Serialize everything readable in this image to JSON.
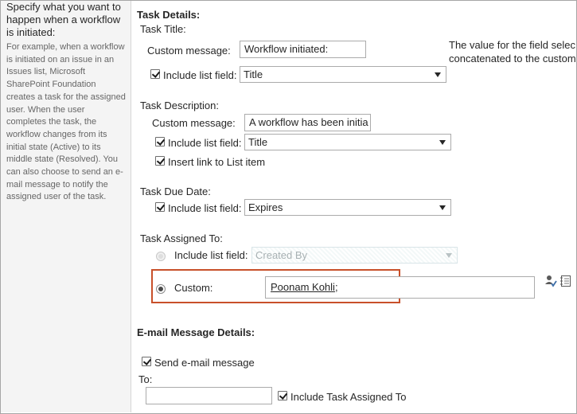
{
  "sidebar": {
    "heading": "Specify what you want to happen when a workflow is initiated:",
    "description": "For example, when a workflow is initiated on an issue in an Issues list, Microsoft SharePoint Foundation creates a task for the assigned user. When the user completes the task, the workflow changes from its initial state (Active) to its middle state (Resolved). You can also choose to send an e-mail message to notify the assigned user of the task."
  },
  "task_details": {
    "title": "Task Details:",
    "task_title": {
      "label": "Task Title:",
      "custom_message_label": "Custom message:",
      "custom_message_value": "Workflow initiated:",
      "include_label": "Include list field:",
      "include_checked": true,
      "field_value": "Title",
      "note_line1": "The value for the field selec",
      "note_line2": "concatenated to the custom"
    },
    "task_description": {
      "label": "Task Description:",
      "custom_message_label": "Custom message:",
      "custom_message_value": "A workflow has been initia",
      "include_label": "Include list field:",
      "include_checked": true,
      "field_value": "Title",
      "insert_link_label": "Insert link to List item",
      "insert_link_checked": true
    },
    "task_due_date": {
      "label": "Task Due Date:",
      "include_label": "Include list field:",
      "include_checked": true,
      "field_value": "Expires"
    },
    "task_assigned_to": {
      "label": "Task Assigned To:",
      "include_label": "Include list field:",
      "field_value": "Created By",
      "custom_label": "Custom:",
      "custom_value": "Poonam Kohli",
      "custom_suffix": ";",
      "selected": "custom"
    }
  },
  "email_details": {
    "title": "E-mail Message Details:",
    "send_label": "Send e-mail message",
    "send_checked": true,
    "to_label": "To:",
    "to_value": "",
    "include_assigned_label": "Include Task Assigned To",
    "include_assigned_checked": true
  },
  "icons": {
    "check_names": "check-names-icon",
    "browse": "address-book-icon"
  },
  "colors": {
    "highlight_border": "#c8502a",
    "left_panel_bg": "#f4f4f4",
    "description_text": "#666666"
  }
}
